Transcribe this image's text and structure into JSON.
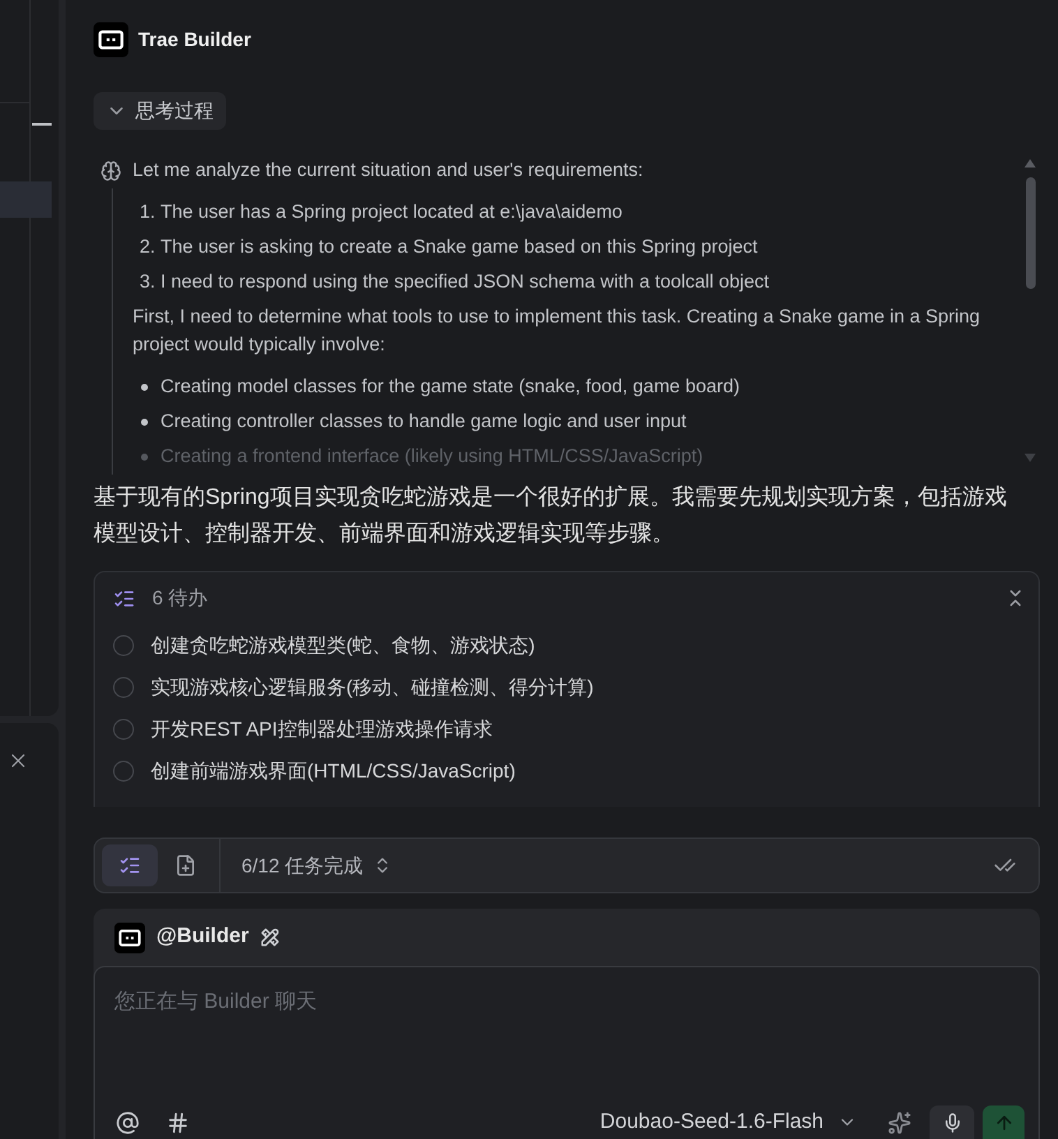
{
  "explorer": {
    "rows": [
      {
        "selected": true
      }
    ]
  },
  "assistant": {
    "name": "Trae Builder"
  },
  "thinking": {
    "label": "思考过程",
    "expanded": true,
    "intro": "Let me analyze the current situation and user's requirements:",
    "steps": [
      {
        "number": "1.",
        "text": "The user has a Spring project located at e:\\java\\aidemo"
      },
      {
        "number": "2.",
        "text": "The user is asking to create a Snake game based on this Spring project"
      },
      {
        "number": "3.",
        "text": "I need to respond using the specified JSON schema with a toolcall object"
      }
    ],
    "paragraph": "First, I need to determine what tools to use to implement this task. Creating a Snake game in a Spring project would typically involve:",
    "bullets": [
      "Creating model classes for the game state (snake, food, game board)",
      "Creating controller classes to handle game logic and user input",
      "Creating a frontend interface (likely using HTML/CSS/JavaScript)"
    ]
  },
  "reply": "基于现有的Spring项目实现贪吃蛇游戏是一个很好的扩展。我需要先规划实现方案，包括游戏模型设计、控制器开发、前端界面和游戏逻辑实现等步骤。",
  "todo": {
    "title": "6 待办",
    "items": [
      {
        "text": "创建贪吃蛇游戏模型类(蛇、食物、游戏状态)",
        "done": false
      },
      {
        "text": "实现游戏核心逻辑服务(移动、碰撞检测、得分计算)",
        "done": false
      },
      {
        "text": "开发REST API控制器处理游戏操作请求",
        "done": false
      },
      {
        "text": "创建前端游戏界面(HTML/CSS/JavaScript)",
        "done": false
      }
    ]
  },
  "task_bar": {
    "tabs": [
      {
        "kind": "todo",
        "selected": true
      },
      {
        "kind": "file",
        "selected": false
      }
    ],
    "progress": "6/12 任务完成"
  },
  "composer": {
    "agent": "@Builder",
    "placeholder": "您正在与 Builder 聊天",
    "model": "Doubao-Seed-1.6-Flash"
  }
}
